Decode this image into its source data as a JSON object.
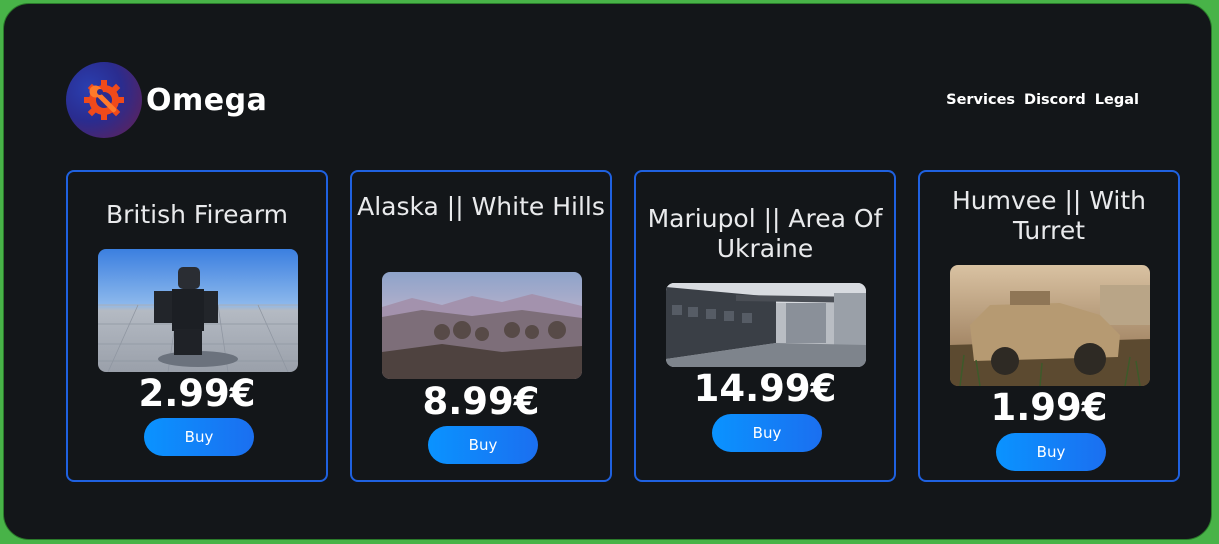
{
  "header": {
    "brand_name": "Omega",
    "logo_icon": "wrench-gear-icon",
    "nav": [
      "Services",
      "Discord",
      "Legal"
    ]
  },
  "colors": {
    "page_border": "#48b348",
    "background": "#131619",
    "card_border": "#1f61e0",
    "button_start": "#0a93ff",
    "button_end": "#1b6ff0"
  },
  "products": [
    {
      "title": "British Firearm",
      "price": "2.99€",
      "button": "Buy",
      "image": "soldier-character-image"
    },
    {
      "title": "Alaska || White Hills",
      "price": "8.99€",
      "button": "Buy",
      "image": "snowy-mountains-image"
    },
    {
      "title": "Mariupol || Area Of Ukraine",
      "price": "14.99€",
      "button": "Buy",
      "image": "train-station-image"
    },
    {
      "title": "Humvee || With Turret",
      "price": "1.99€",
      "button": "Buy",
      "image": "humvee-vehicle-image"
    }
  ]
}
